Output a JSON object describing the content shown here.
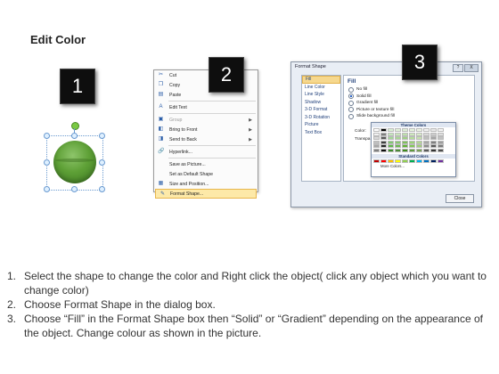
{
  "title": "Edit Color",
  "step_numbers": [
    "1",
    "2",
    "3"
  ],
  "context_menu": {
    "items": [
      {
        "label": "Cut",
        "icon": "scissors-icon",
        "glyph": "✂",
        "disabled": false,
        "submenu": false
      },
      {
        "label": "Copy",
        "icon": "copy-icon",
        "glyph": "❐",
        "disabled": false,
        "submenu": false
      },
      {
        "label": "Paste",
        "icon": "paste-icon",
        "glyph": "▤",
        "disabled": false,
        "submenu": false
      },
      {
        "sep": true
      },
      {
        "label": "Edit Text",
        "icon": "edit-text-icon",
        "glyph": "A",
        "disabled": false,
        "submenu": false
      },
      {
        "sep": true
      },
      {
        "label": "Group",
        "icon": "group-icon",
        "glyph": "▣",
        "disabled": true,
        "submenu": true
      },
      {
        "label": "Bring to Front",
        "icon": "bring-front-icon",
        "glyph": "◧",
        "disabled": false,
        "submenu": true
      },
      {
        "label": "Send to Back",
        "icon": "send-back-icon",
        "glyph": "◨",
        "disabled": false,
        "submenu": true
      },
      {
        "sep": true
      },
      {
        "label": "Hyperlink...",
        "icon": "hyperlink-icon",
        "glyph": "🔗",
        "disabled": false,
        "submenu": false
      },
      {
        "sep": true
      },
      {
        "label": "Save as Picture...",
        "icon": "",
        "glyph": "",
        "disabled": false,
        "submenu": false
      },
      {
        "label": "Set as Default Shape",
        "icon": "",
        "glyph": "",
        "disabled": false,
        "submenu": false
      },
      {
        "label": "Size and Position...",
        "icon": "size-position-icon",
        "glyph": "▦",
        "disabled": false,
        "submenu": false
      },
      {
        "label": "Format Shape...",
        "icon": "format-shape-icon",
        "glyph": "✎",
        "disabled": false,
        "submenu": false,
        "highlighted": true
      }
    ]
  },
  "dialog": {
    "title": "Format Shape",
    "help": "?",
    "close_x": "X",
    "nav": [
      "Fill",
      "Line Color",
      "Line Style",
      "Shadow",
      "3-D Format",
      "3-D Rotation",
      "Picture",
      "Text Box"
    ],
    "selected_nav": "Fill",
    "section_title": "Fill",
    "options": [
      "No fill",
      "Solid fill",
      "Gradient fill",
      "Picture or texture fill",
      "Slide background fill"
    ],
    "selected_option": "Solid fill",
    "color_label": "Color:",
    "transparency_label": "Transpa",
    "close_button": "Close",
    "palette": {
      "theme_title": "Theme Colors",
      "standard_title": "Standard Colors",
      "more": "More Colors...",
      "theme_columns": [
        [
          "#ffffff",
          "#f2f2f2",
          "#d9d9d9",
          "#bfbfbf",
          "#a6a6a6",
          "#7f7f7f"
        ],
        [
          "#000000",
          "#7f7f7f",
          "#595959",
          "#3f3f3f",
          "#262626",
          "#0d0d0d"
        ],
        [
          "#d9f0d3",
          "#c4e7bb",
          "#a2d896",
          "#80c970",
          "#5eb84a",
          "#3d8a2c"
        ],
        [
          "#e2f2da",
          "#c8e6b8",
          "#a9d795",
          "#8ac872",
          "#6bb94f",
          "#4c8a38"
        ],
        [
          "#dfefd6",
          "#bfe0ad",
          "#9fd184",
          "#7fc25b",
          "#5fb332",
          "#3f8a1c"
        ],
        [
          "#e6f4dd",
          "#cde9bb",
          "#b4de99",
          "#9bd377",
          "#82c855",
          "#609a3e"
        ],
        [
          "#ecf5e4",
          "#d9ebc9",
          "#c6e1ae",
          "#b3d793",
          "#a0cd78",
          "#7a9e58"
        ],
        [
          "#f2f2f2",
          "#d9d9d9",
          "#bfbfbf",
          "#a6a6a6",
          "#8c8c8c",
          "#595959"
        ],
        [
          "#e8e8e8",
          "#cccccc",
          "#a6a6a6",
          "#808080",
          "#595959",
          "#333333"
        ],
        [
          "#f5f5f5",
          "#dedede",
          "#c2c2c2",
          "#9e9e9e",
          "#7a7a7a",
          "#4d4d4d"
        ]
      ],
      "standard": [
        "#c00000",
        "#ff0000",
        "#ffc000",
        "#ffff00",
        "#92d050",
        "#00b050",
        "#00b0f0",
        "#0070c0",
        "#002060",
        "#7030a0"
      ]
    }
  },
  "instructions": [
    {
      "n": "1.",
      "text": "Select the shape to change the color and Right click the object( click any object which you want to change color)"
    },
    {
      "n": "2.",
      "text": "Choose Format Shape in the dialog box."
    },
    {
      "n": "3.",
      "text": "Choose “Fill” in the Format Shape box then “Solid” or “Gradient” depending on the appearance of the object. Change colour as shown in the picture."
    }
  ]
}
